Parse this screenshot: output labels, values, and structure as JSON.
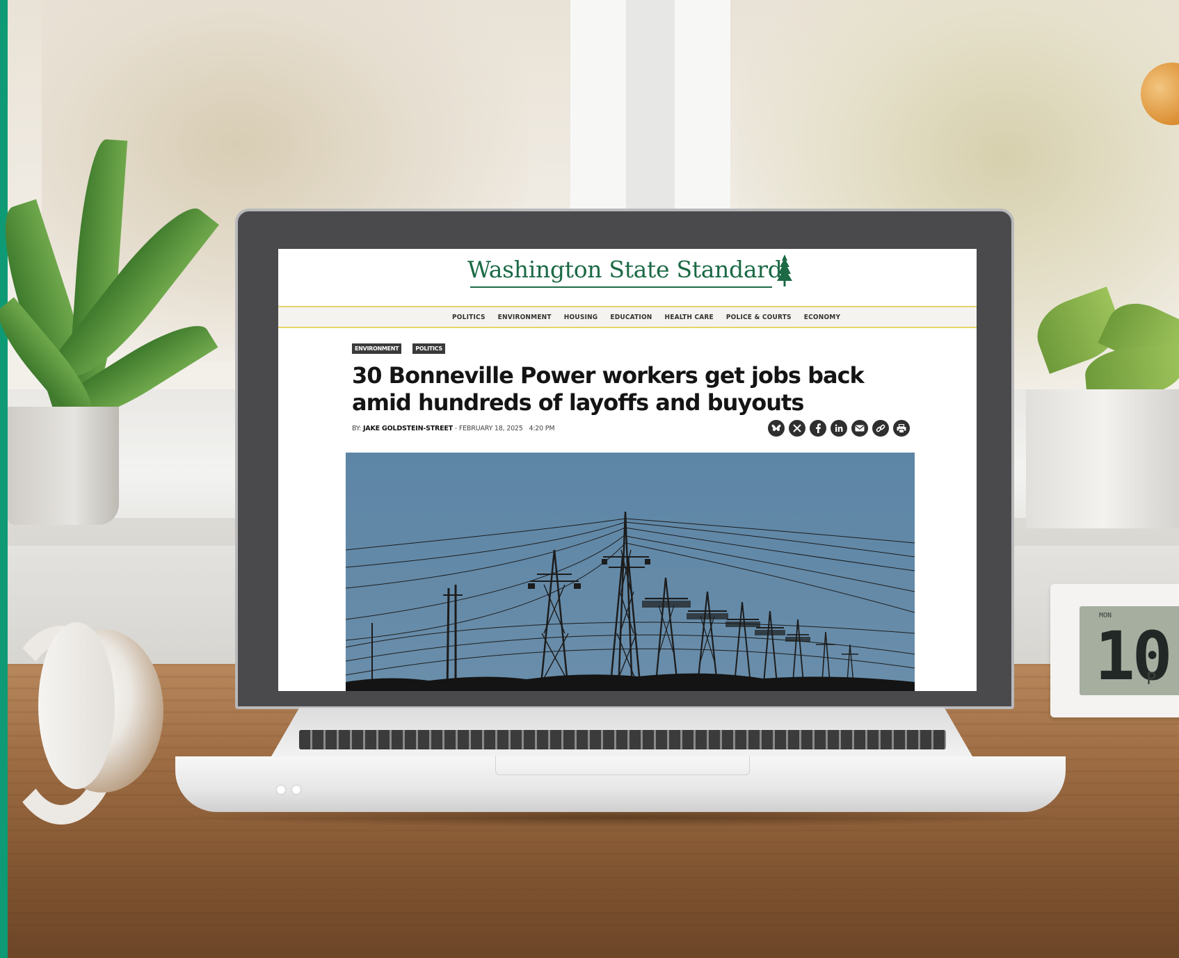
{
  "site": {
    "name": "Washington State Standard",
    "brand_color": "#1b6a45",
    "nav_accent_color": "#e8d36a"
  },
  "nav": {
    "items": [
      "POLITICS",
      "ENVIRONMENT",
      "HOUSING",
      "EDUCATION",
      "HEALTH CARE",
      "POLICE & COURTS",
      "ECONOMY"
    ]
  },
  "article": {
    "tags": [
      "ENVIRONMENT",
      "POLITICS"
    ],
    "headline": "30 Bonneville Power workers get jobs back amid hundreds of layoffs and buyouts",
    "byline": {
      "prefix": "BY:",
      "author": "JAKE GOLDSTEIN-STREET",
      "separator": "-",
      "date": "FEBRUARY 18, 2025",
      "time": "4:20 PM"
    },
    "share_icons": [
      "bluesky-icon",
      "x-icon",
      "facebook-icon",
      "linkedin-icon",
      "email-icon",
      "link-icon",
      "print-icon"
    ],
    "hero_image": "power-transmission-towers-photo"
  },
  "clock": {
    "day": "MON",
    "time": "10:",
    "ampm": "P"
  }
}
